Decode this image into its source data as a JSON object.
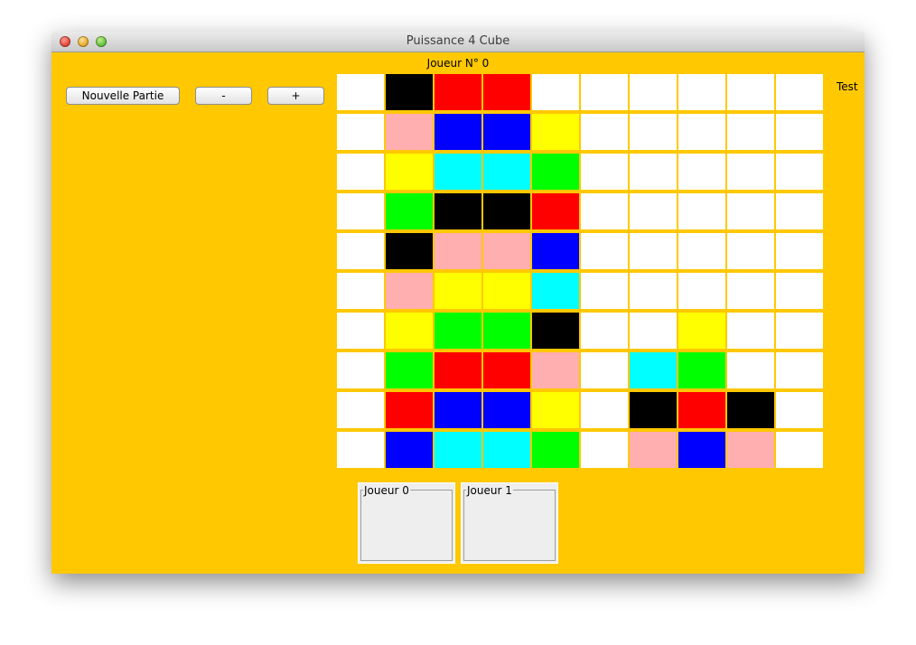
{
  "window": {
    "title": "Puissance 4 Cube"
  },
  "status": {
    "current_player": "Joueur N° 0"
  },
  "side_label": "Test",
  "toolbar": {
    "new_game_label": "Nouvelle Partie",
    "minus_label": "-",
    "plus_label": "+"
  },
  "board": {
    "rows": 10,
    "cols": 10,
    "palette": {
      "W": "#ffffff",
      "K": "#000000",
      "R": "#ff0000",
      "B": "#0000ff",
      "Y": "#ffff00",
      "C": "#00ffff",
      "G": "#00ff00",
      "P": "#ffafaf"
    },
    "cells": [
      [
        "W",
        "K",
        "R",
        "R",
        "W",
        "W",
        "W",
        "W",
        "W",
        "W"
      ],
      [
        "W",
        "P",
        "B",
        "B",
        "Y",
        "W",
        "W",
        "W",
        "W",
        "W"
      ],
      [
        "W",
        "Y",
        "C",
        "C",
        "G",
        "W",
        "W",
        "W",
        "W",
        "W"
      ],
      [
        "W",
        "G",
        "K",
        "K",
        "R",
        "W",
        "W",
        "W",
        "W",
        "W"
      ],
      [
        "W",
        "K",
        "P",
        "P",
        "B",
        "W",
        "W",
        "W",
        "W",
        "W"
      ],
      [
        "W",
        "P",
        "Y",
        "Y",
        "C",
        "W",
        "W",
        "W",
        "W",
        "W"
      ],
      [
        "W",
        "Y",
        "G",
        "G",
        "K",
        "W",
        "W",
        "Y",
        "W",
        "W"
      ],
      [
        "W",
        "G",
        "R",
        "R",
        "P",
        "W",
        "C",
        "G",
        "W",
        "W"
      ],
      [
        "W",
        "R",
        "B",
        "B",
        "Y",
        "W",
        "K",
        "R",
        "K",
        "W"
      ],
      [
        "W",
        "B",
        "C",
        "C",
        "G",
        "W",
        "P",
        "B",
        "P",
        "W"
      ]
    ]
  },
  "players": [
    {
      "label": "Joueur 0"
    },
    {
      "label": "Joueur 1"
    }
  ],
  "colors": {
    "background": "#ffc800"
  }
}
